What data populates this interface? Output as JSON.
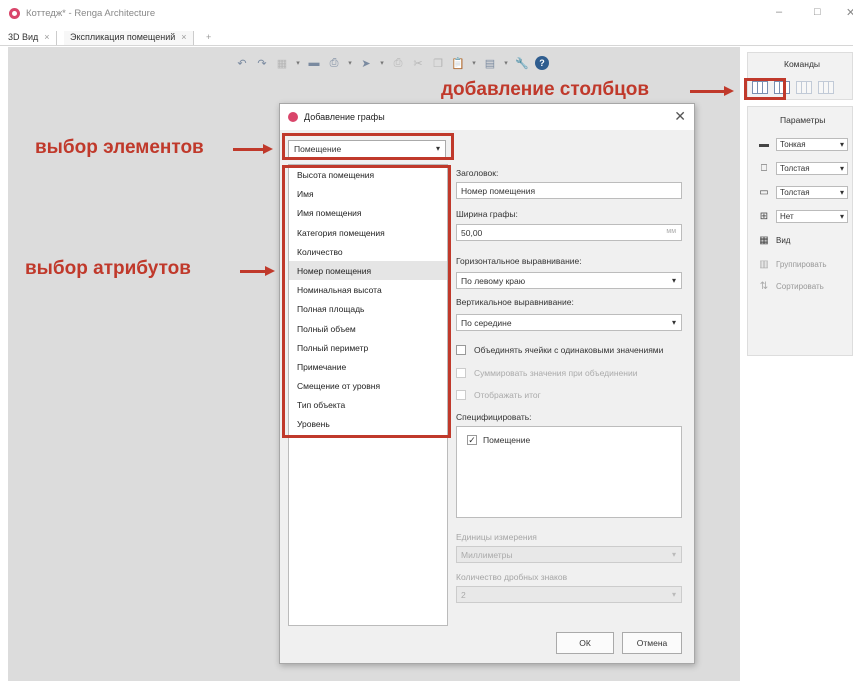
{
  "window": {
    "title": "Коттедж* - Renga Architecture"
  },
  "tabs": [
    {
      "label": "3D Вид"
    },
    {
      "label": "Экспликация помещений"
    }
  ],
  "commands_panel": {
    "title": "Команды"
  },
  "params_panel": {
    "title": "Параметры",
    "rows": [
      {
        "icon": "line-thin-icon",
        "value": "Тонкая"
      },
      {
        "icon": "border-thick-icon",
        "value": "Толстая"
      },
      {
        "icon": "frame-thick-icon",
        "value": "Толстая"
      },
      {
        "icon": "table-merge-icon",
        "value": "Нет"
      },
      {
        "icon": "table-view-icon",
        "value": "Вид"
      }
    ],
    "group_label": "Группировать",
    "sort_label": "Сортировать"
  },
  "dialog": {
    "title": "Добавление графы",
    "element_select": "Помещение",
    "attributes": [
      "Высота помещения",
      "Имя",
      "Имя помещения",
      "Категория помещения",
      "Количество",
      "Номер помещения",
      "Номинальная высота",
      "Полная площадь",
      "Полный объем",
      "Полный периметр",
      "Примечание",
      "Смещение от уровня",
      "Тип объекта",
      "Уровень"
    ],
    "selected_attribute_index": 5,
    "header_label": "Заголовок:",
    "header_value": "Номер помещения",
    "width_label": "Ширина графы:",
    "width_value": "50,00",
    "width_unit": "мм",
    "halign_label": "Горизонтальное выравнивание:",
    "halign_value": "По левому краю",
    "valign_label": "Вертикальное выравнивание:",
    "valign_value": "По середине",
    "merge_label": "Объединять ячейки с одинаковыми значениями",
    "sum_label": "Суммировать значения при объединении",
    "total_label": "Отображать итог",
    "spec_label": "Специфицировать:",
    "spec_item": "Помещение",
    "units_label": "Единицы измерения",
    "units_value": "Миллиметры",
    "decimals_label": "Количество дробных знаков",
    "decimals_value": "2",
    "ok_label": "ОК",
    "cancel_label": "Отмена"
  },
  "annotations": {
    "columns": "добавление столбцов",
    "elements": "выбор элементов",
    "attributes": "выбор атрибутов"
  },
  "colors": {
    "annotation": "#c0392b",
    "selected_row": "#e5e5e5",
    "workspace": "#dcdcdc"
  }
}
